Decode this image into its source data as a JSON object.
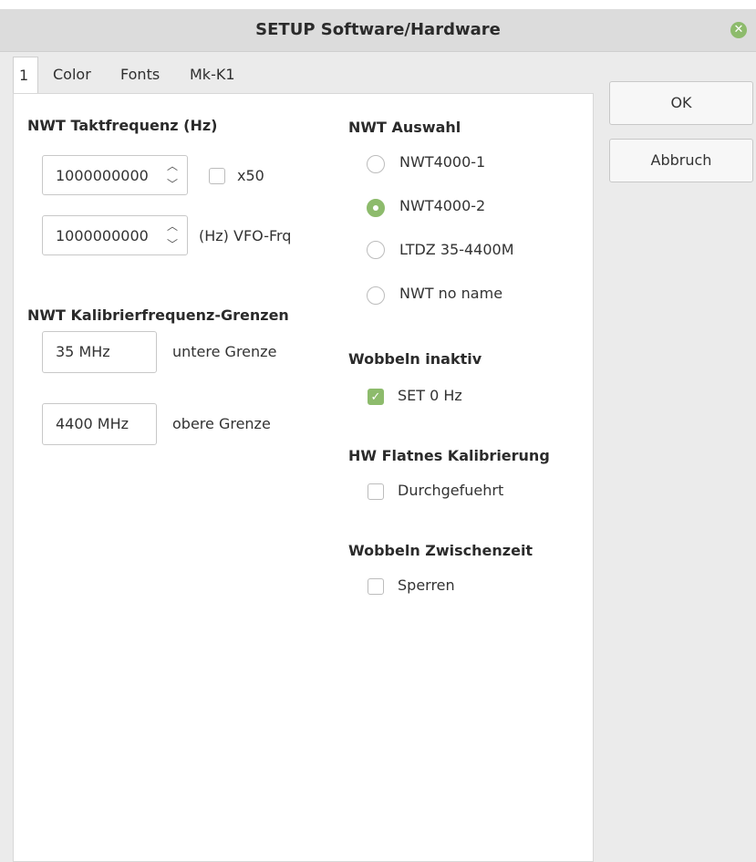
{
  "window": {
    "title": "SETUP Software/Hardware",
    "close_icon": "close-icon"
  },
  "tabs": [
    "1",
    "Color",
    "Fonts",
    "Mk-K1"
  ],
  "buttons": {
    "ok": "OK",
    "cancel": "Abbruch"
  },
  "takt": {
    "header": "NWT Taktfrequenz (Hz)",
    "freq1": "1000000000",
    "x50_label": "x50",
    "freq2": "1000000000",
    "vfo_label": "(Hz)  VFO-Frq"
  },
  "kalib": {
    "header": "NWT Kalibrierfrequenz-Grenzen",
    "lower_value": "35 MHz",
    "lower_label": "untere Grenze",
    "upper_value": "4400 MHz",
    "upper_label": "obere Grenze"
  },
  "auswahl": {
    "header": "NWT Auswahl",
    "options": [
      "NWT4000-1",
      "NWT4000-2",
      "LTDZ 35-4400M",
      "NWT no name"
    ],
    "selected": "NWT4000-2"
  },
  "wobbeln_inaktiv": {
    "header": "Wobbeln inaktiv",
    "checkbox_label": "SET 0 Hz",
    "checked": true
  },
  "hw_flatnes": {
    "header": "HW Flatnes Kalibrierung",
    "checkbox_label": "Durchgefuehrt",
    "checked": false
  },
  "wobbeln_zwischenzeit": {
    "header": "Wobbeln Zwischenzeit",
    "checkbox_label": "Sperren",
    "checked": false
  },
  "colors": {
    "accent": "#8dbb6c",
    "titlebar": "#dcdcdc",
    "background": "#ebebeb",
    "panel": "#ffffff"
  }
}
